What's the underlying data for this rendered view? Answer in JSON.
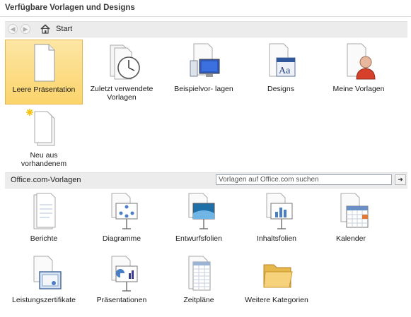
{
  "header": {
    "title": "Verfügbare Vorlagen und Designs"
  },
  "nav": {
    "back_icon": "back-arrow-icon",
    "forward_icon": "forward-arrow-icon",
    "home_icon": "home-icon",
    "location": "Start"
  },
  "templates": {
    "blank": "Leere Präsentation",
    "recent": "Zuletzt verwendete Vorlagen",
    "samples": "Beispielvor- lagen",
    "designs": "Designs",
    "mine": "Meine Vorlagen",
    "from_existing": "Neu aus vorhandenem"
  },
  "office": {
    "label": "Office.com-Vorlagen",
    "search_placeholder": "Vorlagen auf Office.com suchen",
    "go_icon": "arrow-right-icon",
    "items": {
      "reports": "Berichte",
      "diagrams": "Diagramme",
      "design_slides": "Entwurfsfolien",
      "content_slides": "Inhaltsfolien",
      "calendar": "Kalender",
      "certificates": "Leistungszertifikate",
      "presentations": "Präsentationen",
      "schedules": "Zeitpläne",
      "more": "Weitere Kategorien"
    }
  },
  "colors": {
    "selected_fill": "#fbd46b",
    "selected_border": "#e8b54a",
    "bar_bg": "#ececec"
  }
}
